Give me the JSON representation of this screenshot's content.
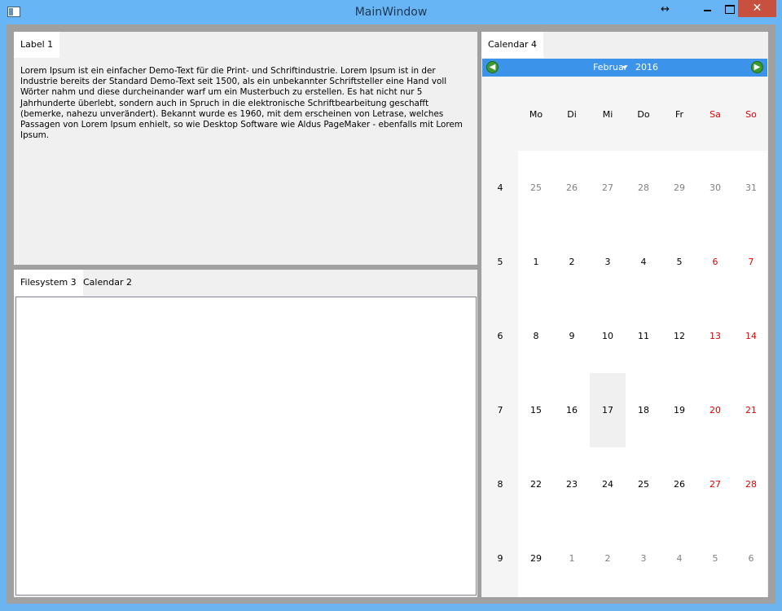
{
  "window": {
    "title": "MainWindow",
    "resize_glyph": "↔",
    "close_glyph": "✕"
  },
  "label_pane": {
    "tab": "Label 1",
    "text": "Lorem Ipsum ist ein einfacher Demo-Text für die Print- und Schriftindustrie. Lorem Ipsum ist in der Industrie bereits der Standard Demo-Text seit 1500, als ein unbekannter Schriftsteller eine Hand voll Wörter nahm und diese durcheinander warf um ein Musterbuch zu erstellen. Es hat nicht nur 5 Jahrhunderte überlebt, sondern auch in Spruch in die elektronische Schriftbearbeitung geschafft (bemerke, nahezu unverändert). Bekannt wurde es 1960, mit dem erscheinen von Letrase, welches Passagen von Lorem Ipsum enhielt, so wie Desktop Software wie Aldus PageMaker - ebenfalls mit Lorem Ipsum."
  },
  "bottom_pane": {
    "tabs": [
      "Filesystem 3",
      "Calendar 2"
    ],
    "active_tab": 0
  },
  "calendar": {
    "tab": "Calendar 4",
    "month": "Februar",
    "year": "2016",
    "weekdays": [
      "Mo",
      "Di",
      "Mi",
      "Do",
      "Fr",
      "Sa",
      "So"
    ],
    "weeks": [
      {
        "week": "4",
        "days": [
          "25",
          "26",
          "27",
          "28",
          "29",
          "30",
          "31"
        ]
      },
      {
        "week": "5",
        "days": [
          "1",
          "2",
          "3",
          "4",
          "5",
          "6",
          "7"
        ]
      },
      {
        "week": "6",
        "days": [
          "8",
          "9",
          "10",
          "11",
          "12",
          "13",
          "14"
        ]
      },
      {
        "week": "7",
        "days": [
          "15",
          "16",
          "17",
          "18",
          "19",
          "20",
          "21"
        ]
      },
      {
        "week": "8",
        "days": [
          "22",
          "23",
          "24",
          "25",
          "26",
          "27",
          "28"
        ]
      },
      {
        "week": "9",
        "days": [
          "29",
          "1",
          "2",
          "3",
          "4",
          "5",
          "6"
        ]
      }
    ],
    "selected_day": "17",
    "colors": {
      "header": "#3b93ea",
      "weekend": "#e00000",
      "other_month": "#808080",
      "nav_arrow": "#3c9a30"
    }
  },
  "icons": [
    "app-icon",
    "resize-icon",
    "minimize-icon",
    "maximize-icon",
    "close-icon",
    "arrow-left-icon",
    "arrow-right-icon",
    "chevron-down-icon"
  ]
}
